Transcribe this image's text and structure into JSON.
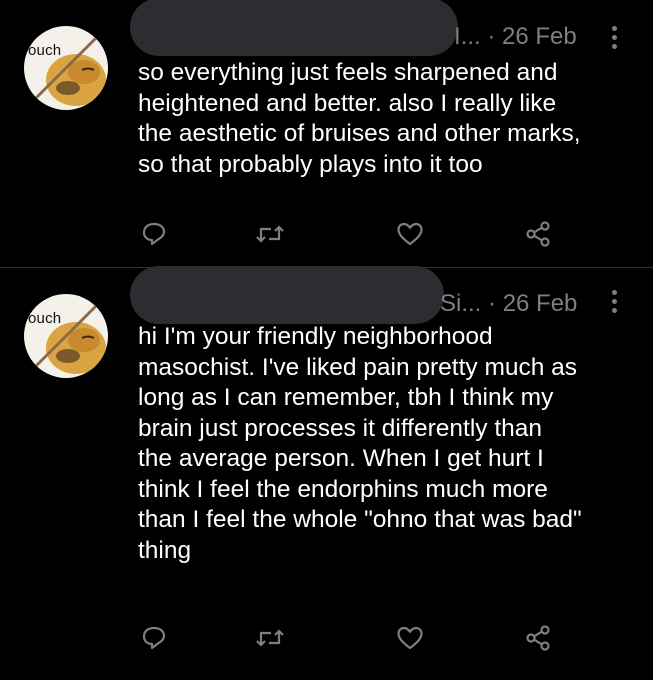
{
  "tweets": [
    {
      "avatar_text": "ouch",
      "handle_tail": "I...",
      "separator": "·",
      "date": "26 Feb",
      "body_lines": [
        "so everything just feels sharpened and",
        "heightened and better. also I really like",
        "the aesthetic of bruises and other marks,",
        "so that probably plays into it too"
      ],
      "actions": [
        "reply-icon",
        "retweet-icon",
        "like-icon",
        "share-icon"
      ]
    },
    {
      "avatar_text": "ouch",
      "handle_tail": "Si...",
      "separator": "·",
      "date": "26 Feb",
      "body_lines": [
        "hi I'm your friendly neighborhood",
        "masochist. I've liked pain pretty much as",
        "long as I can remember, tbh I think my",
        "brain just processes it differently than",
        "the average person. When I get hurt I",
        "think I feel the endorphins much more",
        "than I feel the whole \"ohno that was bad\"",
        "thing"
      ],
      "actions": [
        "reply-icon",
        "retweet-icon",
        "like-icon",
        "share-icon"
      ]
    }
  ],
  "colors": {
    "background": "#000000",
    "text": "#ffffff",
    "muted": "#7c7f84",
    "name_redaction": "#2c2d30"
  }
}
